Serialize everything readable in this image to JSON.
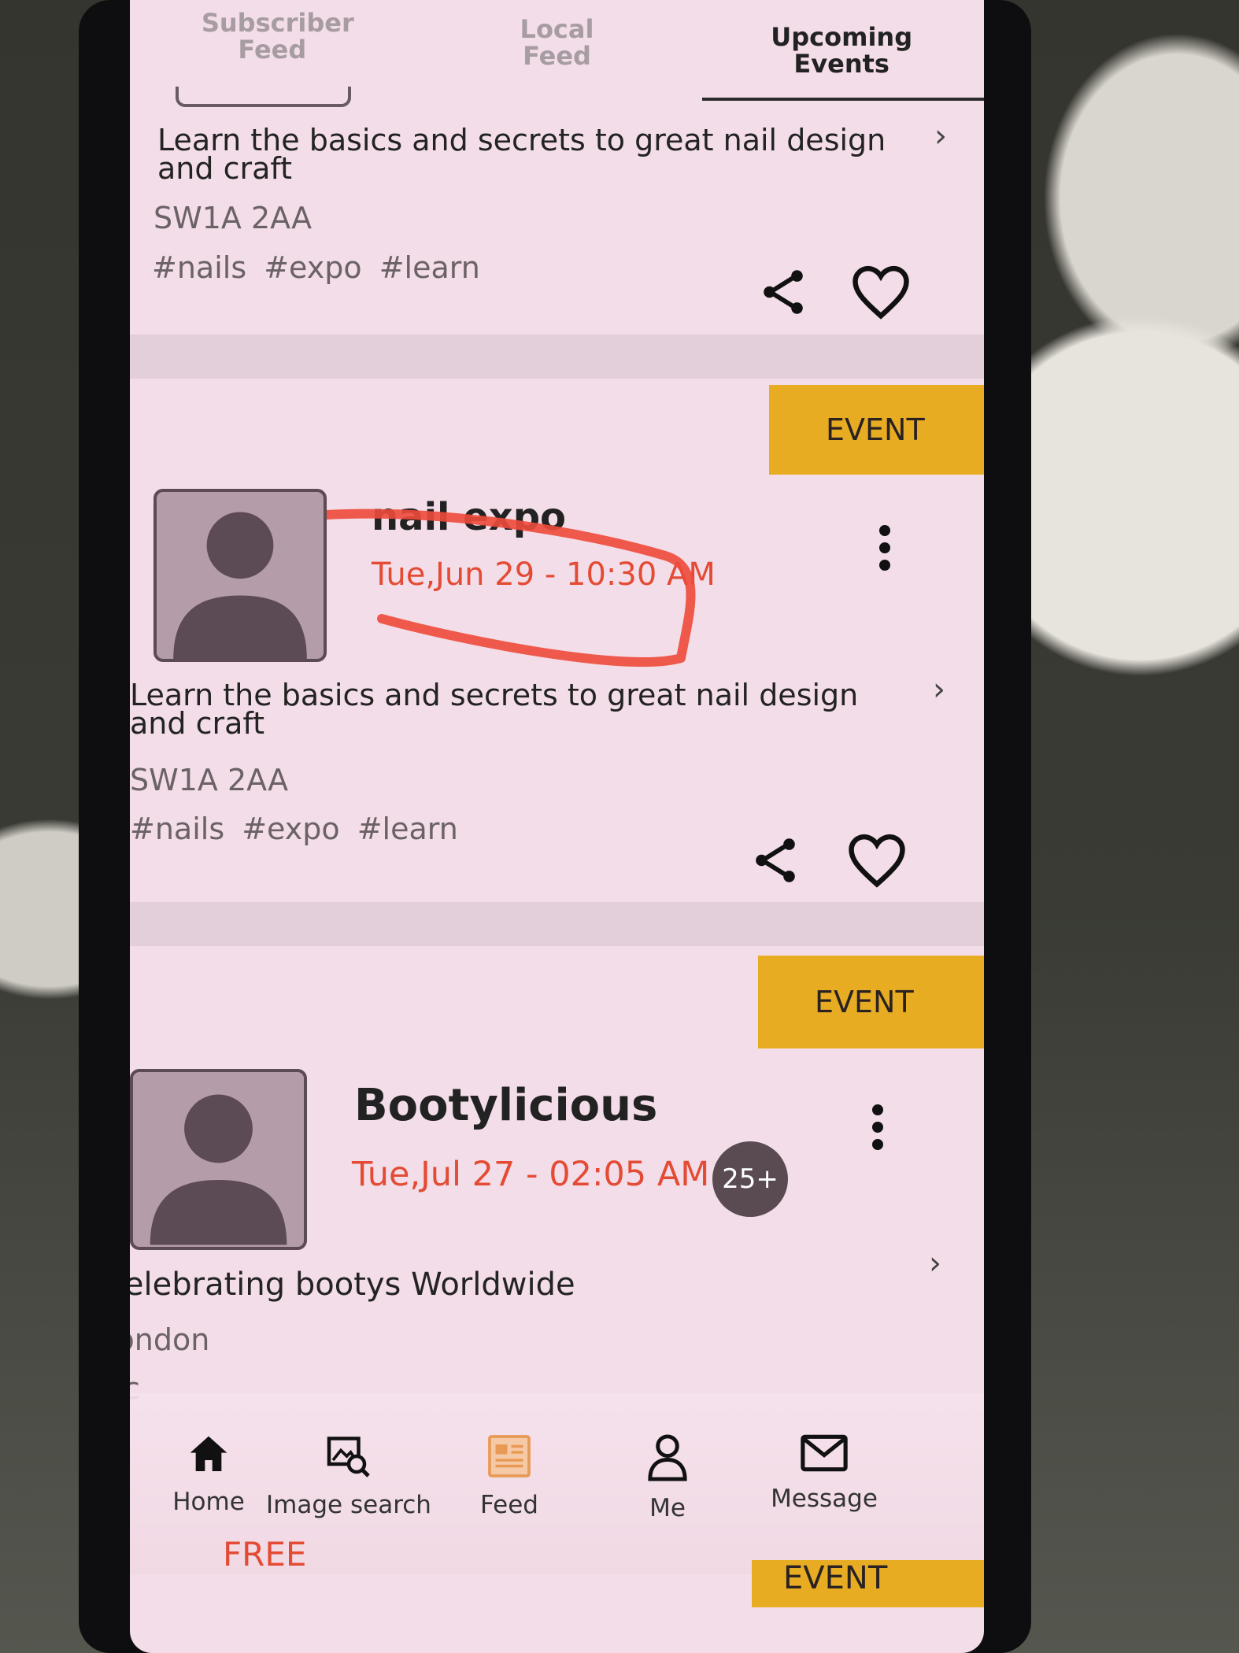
{
  "tabs": [
    {
      "label": "Subscriber Feed"
    },
    {
      "label": "Local Feed"
    },
    {
      "label": "Upcoming Events"
    }
  ],
  "cards": [
    {
      "description": "Learn the basics and secrets to great nail design and craft",
      "postcode": "SW1A 2AA",
      "tags": "#nails #expo #learn"
    },
    {
      "badge": "EVENT",
      "title": "nail expo",
      "date": "Tue,Jun 29 - 10:30 AM",
      "description": "Learn the basics and secrets to great nail design and craft",
      "postcode": "SW1A 2AA",
      "tags": "#nails #expo #learn"
    },
    {
      "badge": "EVENT",
      "title": "Bootylicious",
      "date": "Tue,Jul 27 - 02:05 AM",
      "count": "25+",
      "description": "Celebrating bootys Worldwide",
      "location": "London",
      "tags": "#c"
    }
  ],
  "nav": {
    "items": [
      {
        "label": "Home",
        "icon": "home-icon"
      },
      {
        "label": "Image search",
        "icon": "image-search-icon"
      },
      {
        "label": "Feed",
        "icon": "feed-icon"
      },
      {
        "label": "Me",
        "icon": "person-icon"
      },
      {
        "label": "Message",
        "icon": "mail-icon"
      }
    ]
  },
  "footer": {
    "free_label": "FREE",
    "event_label": "EVENT"
  },
  "colors": {
    "accent": "#e8ac23",
    "date": "#e44b34",
    "background": "#f3dde8"
  }
}
